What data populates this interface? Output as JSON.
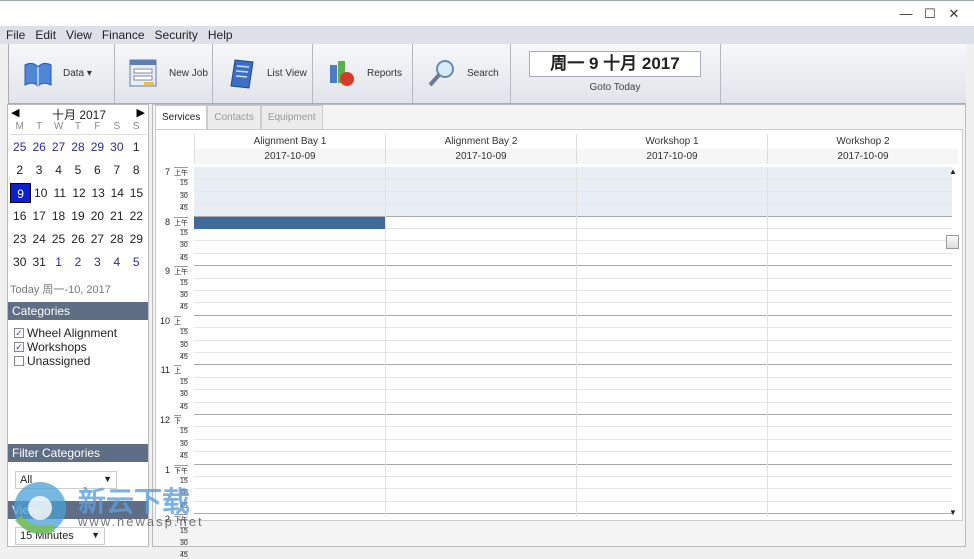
{
  "window": {
    "controls": {
      "minimize": "—",
      "maximize": "☐",
      "close": "✕"
    }
  },
  "menu": [
    "File",
    "Edit",
    "View",
    "Finance",
    "Security",
    "Help"
  ],
  "toolbar": {
    "data_label": "Data ▾",
    "new_job_label": "New Job",
    "list_view_label": "List View",
    "reports_label": "Reports",
    "search_label": "Search",
    "current_date": "周一 9 十月 2017",
    "goto_today_label": "Goto Today"
  },
  "calendar": {
    "month_label": "十月 2017",
    "prev": "◀",
    "next": "▶",
    "weekdays": [
      "M",
      "T",
      "W",
      "T",
      "F",
      "S",
      "S"
    ],
    "weeks": [
      [
        "25",
        "26",
        "27",
        "28",
        "29",
        "30",
        "1"
      ],
      [
        "2",
        "3",
        "4",
        "5",
        "6",
        "7",
        "8"
      ],
      [
        "9",
        "10",
        "11",
        "12",
        "13",
        "14",
        "15"
      ],
      [
        "16",
        "17",
        "18",
        "19",
        "20",
        "21",
        "22"
      ],
      [
        "23",
        "24",
        "25",
        "26",
        "27",
        "28",
        "29"
      ],
      [
        "30",
        "31",
        "1",
        "2",
        "3",
        "4",
        "5"
      ]
    ],
    "selected": "9",
    "today_text": "Today 周一-10, 2017"
  },
  "categories": {
    "header": "Categories",
    "items": [
      {
        "label": "Wheel Alignment",
        "checked": true
      },
      {
        "label": "Workshops",
        "checked": true
      },
      {
        "label": "Unassigned",
        "checked": false
      }
    ]
  },
  "filter": {
    "header": "Filter Categories",
    "value": "All"
  },
  "view": {
    "header": "View",
    "value": "15 Minutes"
  },
  "tabs": [
    {
      "label": "Services",
      "active": true
    },
    {
      "label": "Contacts"
    },
    {
      "label": "Equipment"
    }
  ],
  "resources": [
    {
      "name": "Alignment Bay 1",
      "date": "2017-10-09"
    },
    {
      "name": "Alignment Bay 2",
      "date": "2017-10-09"
    },
    {
      "name": "Workshop 1",
      "date": "2017-10-09"
    },
    {
      "name": "Workshop 2",
      "date": "2017-10-09"
    }
  ],
  "hours": [
    {
      "h": "7",
      "ampm": "上午"
    },
    {
      "h": "8",
      "ampm": "上午"
    },
    {
      "h": "9",
      "ampm": "上午"
    },
    {
      "h": "10",
      "ampm": "上"
    },
    {
      "h": "11",
      "ampm": "上"
    },
    {
      "h": "12",
      "ampm": "下"
    },
    {
      "h": "1",
      "ampm": "下午"
    },
    {
      "h": "2",
      "ampm": "下午"
    }
  ],
  "quarters": [
    "15",
    "30",
    "45"
  ],
  "appointment": {
    "resource": "Alignment Bay 1",
    "start": "8:00",
    "color": "#3f6b9c"
  },
  "watermark": {
    "text": "新云下载",
    "url": "www.newasp.net"
  }
}
